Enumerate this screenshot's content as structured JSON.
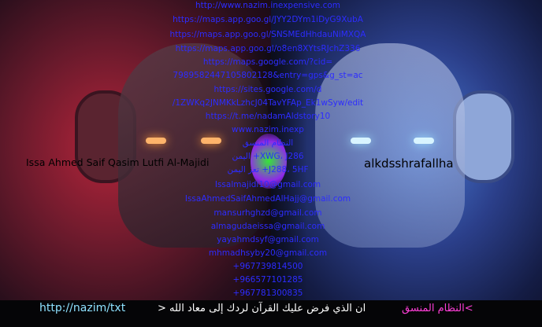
{
  "links": [
    "http://www.nazim.inexpensive.com",
    "https://maps.app.goo.gl/JYY2DYm1iDyG9XubA",
    "https://maps.app.goo.gl/SNSMEdHhdauNiMXQA",
    "https://maps.app.goo.gl/o8en8XYtsRJchZ336",
    "https://maps.google.com/?cid=",
    "7989582447105802128&entry=gps&g_st=ac",
    "https://sites.google.com/d",
    "/1ZWKq2JNMKkLzhcJ04TavYFAp_Ek1wSyw/edit",
    "https://t.me/nadamAldstory10",
    "www.nazim.inexp",
    "النظام المنسق",
    "اليمن +XWG، J286",
    "تعز اليمن +J288، 5HF",
    "Issalmajidi10@gmail.com",
    "IssaAhmedSaifAhmedAlHajj@gmail.com",
    "mansurhghzd@gmail.com",
    "almagudaeissa@gmail.com",
    "yayahmdsyf@gmail.com",
    "mhmadhsyby20@gmail.com",
    "+967739814500",
    "+966577101285",
    "+967781300835"
  ],
  "left_label": "Issa Ahmed Saif Qasim Lutfi Al-Majidi",
  "right_label": "alkdsshrafallha",
  "bottom": {
    "url": "http://nazim/txt",
    "arabic_text": "ان الذي فرض عليك القرآن لردك إلى معاد الله <",
    "pink_text": "النظام المنسق<"
  }
}
